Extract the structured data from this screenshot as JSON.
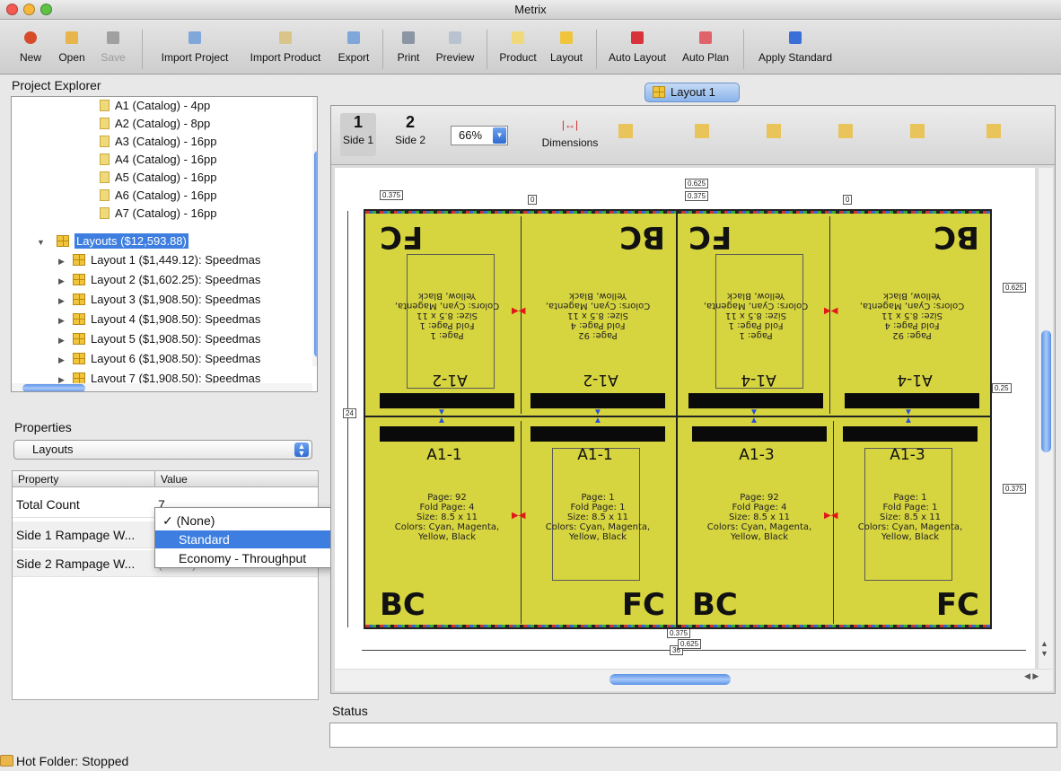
{
  "window": {
    "title": "Metrix"
  },
  "toolbar": {
    "new": "New",
    "open": "Open",
    "save": "Save",
    "import_project": "Import Project",
    "import_product": "Import Product",
    "export": "Export",
    "print": "Print",
    "preview": "Preview",
    "product": "Product",
    "layout": "Layout",
    "auto_layout": "Auto Layout",
    "auto_plan": "Auto Plan",
    "apply_standard": "Apply Standard"
  },
  "project_explorer": {
    "title": "Project Explorer",
    "catalog_items": [
      "A1 (Catalog) - 4pp",
      "A2 (Catalog) - 8pp",
      "A3 (Catalog) - 16pp",
      "A4 (Catalog) - 16pp",
      "A5 (Catalog) - 16pp",
      "A6 (Catalog) - 16pp",
      "A7 (Catalog) - 16pp"
    ],
    "layouts_node": "Layouts ($12,593.88)",
    "layout_items": [
      "Layout 1 ($1,449.12): Speedmas",
      "Layout 2 ($1,602.25): Speedmas",
      "Layout 3 ($1,908.50): Speedmas",
      "Layout 4 ($1,908.50): Speedmas",
      "Layout 5 ($1,908.50): Speedmas",
      "Layout 6 ($1,908.50): Speedmas",
      "Layout 7 ($1,908.50): Speedmas"
    ]
  },
  "properties": {
    "title": "Properties",
    "selector": "Layouts",
    "col_property": "Property",
    "col_value": "Value",
    "rows": [
      {
        "name": "Total Count",
        "value": "7"
      },
      {
        "name": "Side 1 Rampage W...",
        "value": ""
      },
      {
        "name": "Side 2 Rampage W...",
        "value": "(None)"
      }
    ],
    "dropdown": {
      "options": [
        "(None)",
        "Standard",
        "Economy - Throughput"
      ],
      "checked_mark": "✓",
      "highlighted": "Standard"
    }
  },
  "editor": {
    "tab_label": "Layout 1",
    "side1_num": "1",
    "side1_label": "Side 1",
    "side2_num": "2",
    "side2_label": "Side 2",
    "zoom": "66%",
    "dimensions_label": "Dimensions"
  },
  "sheet": {
    "panels_top": [
      {
        "id": "A1-2",
        "big": "FC",
        "page": "Page: 1",
        "fold": "Fold Page: 1"
      },
      {
        "id": "A1-2",
        "big": "BC",
        "page": "Page: 92",
        "fold": "Fold Page: 4"
      },
      {
        "id": "A1-4",
        "big": "FC",
        "page": "Page: 1",
        "fold": "Fold Page: 1"
      },
      {
        "id": "A1-4",
        "big": "BC",
        "page": "Page: 92",
        "fold": "Fold Page: 4"
      }
    ],
    "panels_bottom": [
      {
        "id": "A1-1",
        "big": "BC",
        "page": "Page: 92",
        "fold": "Fold Page: 4"
      },
      {
        "id": "A1-1",
        "big": "FC",
        "page": "Page: 1",
        "fold": "Fold Page: 1"
      },
      {
        "id": "A1-3",
        "big": "BC",
        "page": "Page: 92",
        "fold": "Fold Page: 4"
      },
      {
        "id": "A1-3",
        "big": "FC",
        "page": "Page: 1",
        "fold": "Fold Page: 1"
      }
    ],
    "size": "Size: 8.5 x 11",
    "colors1": "Colors: Cyan, Magenta,",
    "colors2": "Yellow, Black",
    "dims": {
      "d0375": "0.375",
      "d0": "0",
      "d0625": "0.625",
      "d025": "0.25",
      "d24": "24",
      "d36": "36"
    },
    "sheet_color": "#d6d43f"
  },
  "status": {
    "label": "Status",
    "value": ""
  },
  "footer": {
    "hot_folder": "Hot Folder: Stopped"
  }
}
